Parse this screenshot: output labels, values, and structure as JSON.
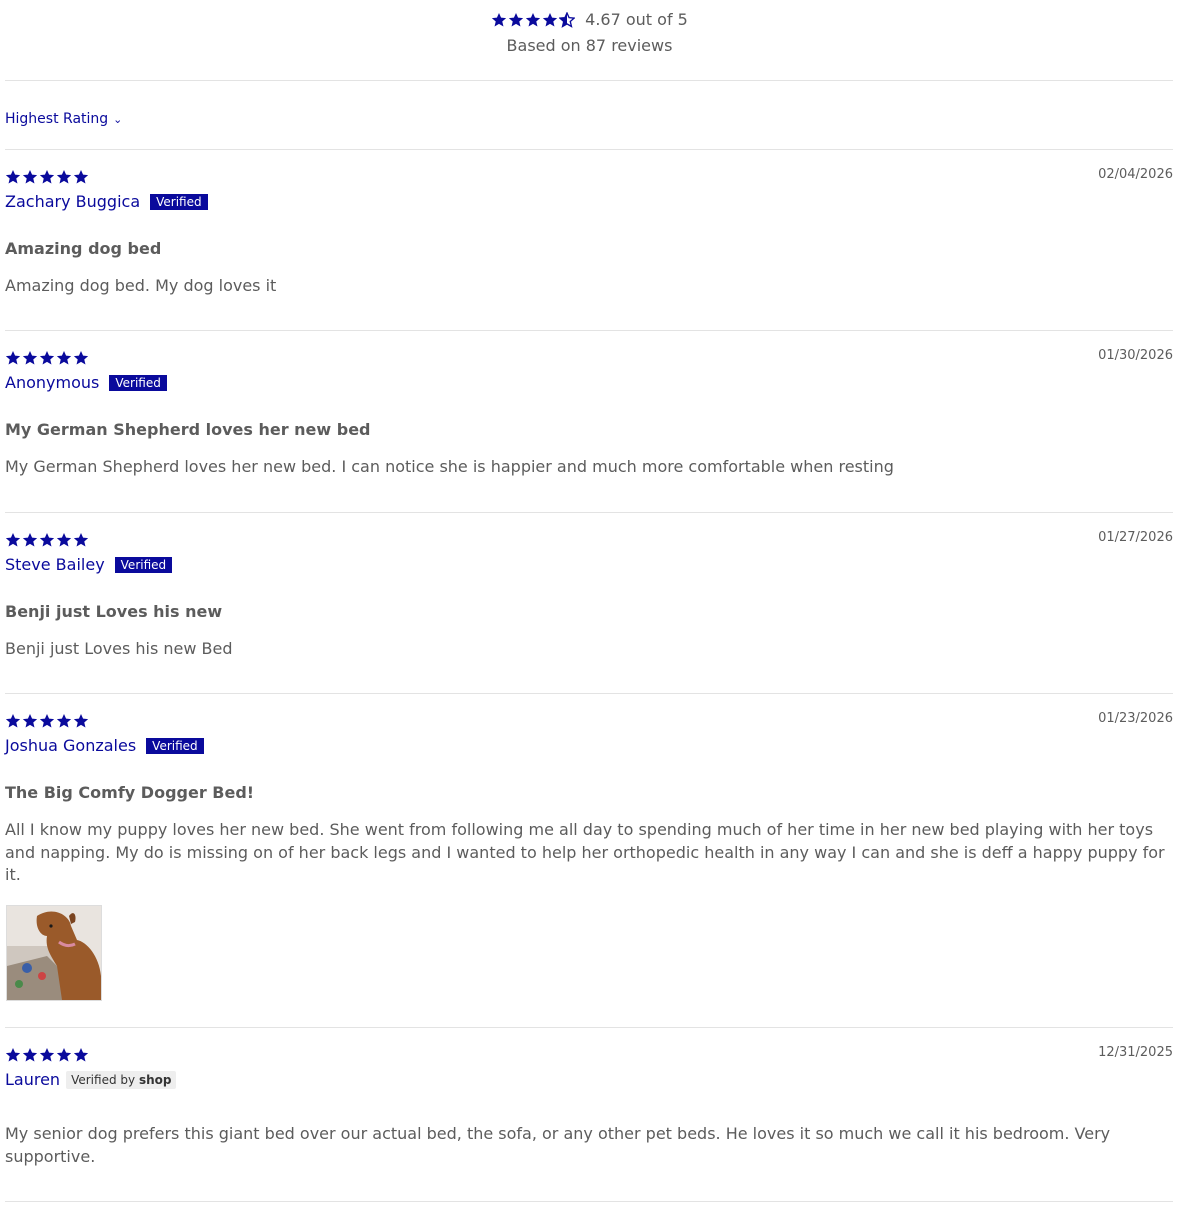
{
  "summary": {
    "rating_text": "4.67 out of 5",
    "based_on": "Based on 87 reviews",
    "average_rating": 4.67,
    "star_color": "#0a0a9c"
  },
  "sort": {
    "label": "Highest Rating",
    "icon": "chevron-down-icon"
  },
  "reviews": [
    {
      "stars": 5,
      "date": "02/04/2026",
      "author": "Zachary Buggica",
      "badge": "Verified",
      "title": "Amazing dog bed",
      "body": "Amazing dog bed. My dog loves it"
    },
    {
      "stars": 5,
      "date": "01/30/2026",
      "author": "Anonymous",
      "badge": "Verified",
      "title": "My German Shepherd loves her new bed",
      "body": "My German Shepherd loves her new bed. I can notice she is happier and much more comfortable when resting"
    },
    {
      "stars": 5,
      "date": "01/27/2026",
      "author": "Steve Bailey",
      "badge": "Verified",
      "title": "Benji just Loves his new",
      "body": "Benji just Loves his new Bed"
    },
    {
      "stars": 5,
      "date": "01/23/2026",
      "author": "Joshua Gonzales",
      "badge": "Verified",
      "title": "The Big Comfy Dogger Bed!",
      "body": "All I know my puppy loves her new bed. She went from following me all day to spending much of her time in her new bed playing with her toys and napping. My do is missing on of her back legs and I wanted to help her orthopedic health in any way I can and she is deff a happy puppy for it."
    },
    {
      "stars": 5,
      "date": "12/31/2025",
      "author": "Lauren",
      "badge_prefix": "Verified by",
      "badge_brand": "shop",
      "body": "My senior dog prefers this giant bed over our actual bed, the sofa, or any other pet beds. He loves it so much we call it his bedroom. Very supportive."
    }
  ]
}
